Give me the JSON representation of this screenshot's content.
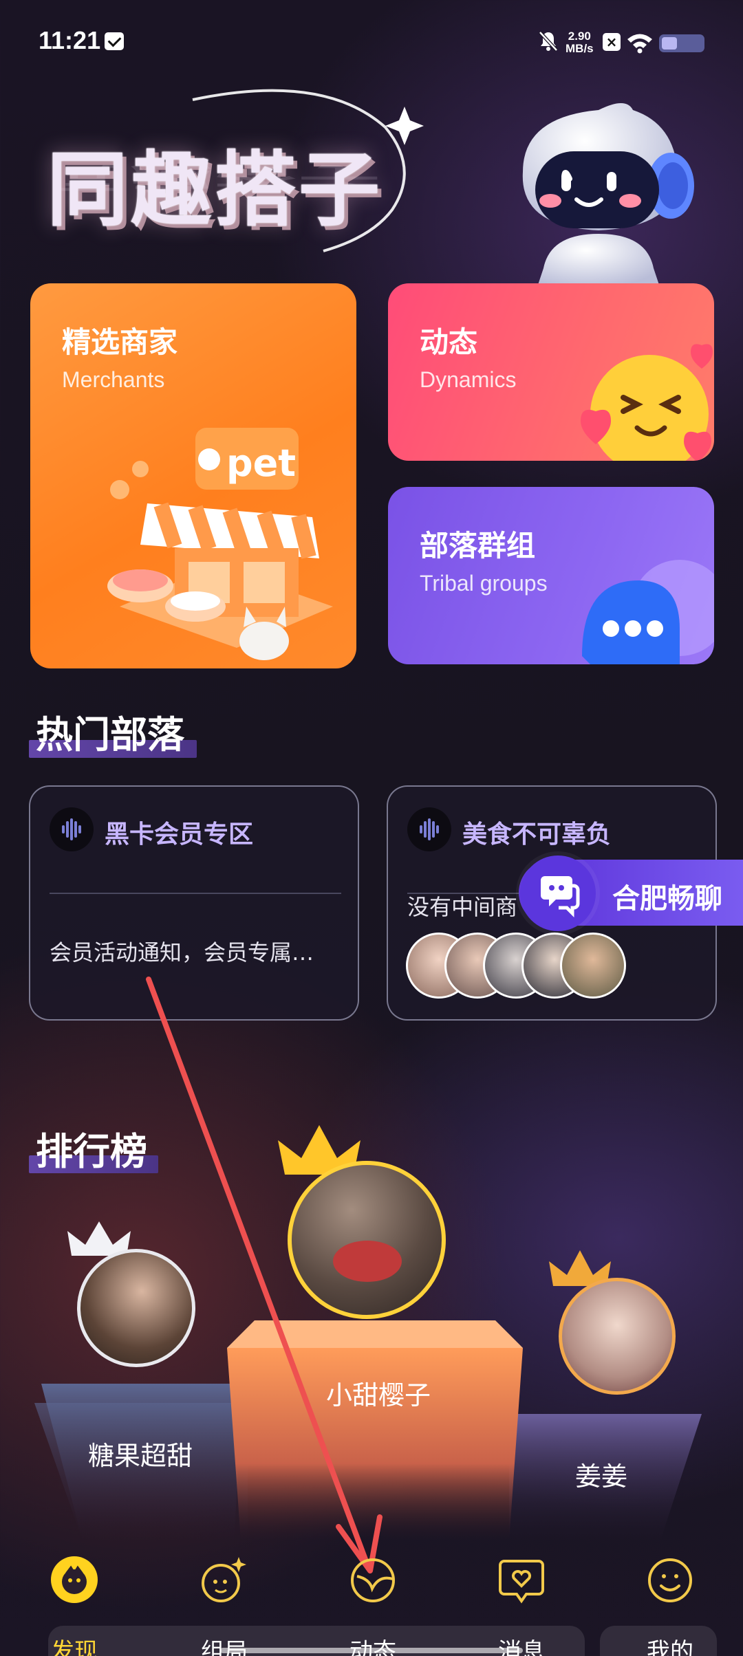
{
  "status_bar": {
    "time": "11:21",
    "net_speed_value": "2.90",
    "net_speed_unit": "MB/s"
  },
  "hero": {
    "title": "同趣搭子"
  },
  "features": [
    {
      "title": "精选商家",
      "subtitle": "Merchants",
      "illustration_text": "pet"
    },
    {
      "title": "动态",
      "subtitle": "Dynamics"
    },
    {
      "title": "部落群组",
      "subtitle": "Tribal groups"
    }
  ],
  "hot_tribes": {
    "title": "热门部落",
    "items": [
      {
        "name": "黑卡会员专区",
        "desc": "会员活动通知，会员专属…"
      },
      {
        "name": "美食不可辜负",
        "desc": "没有中间商"
      }
    ]
  },
  "chat_badge": {
    "label": "合肥畅聊"
  },
  "ranking": {
    "title": "排行榜",
    "first": {
      "name": "小甜樱子"
    },
    "second": {
      "name": "糖果超甜"
    },
    "third": {
      "name": "姜姜"
    }
  },
  "nav": [
    {
      "label": "发现",
      "icon": "discover-icon",
      "active": true
    },
    {
      "label": "组局",
      "icon": "party-icon"
    },
    {
      "label": "动态",
      "icon": "dynamics-icon"
    },
    {
      "label": "消息",
      "icon": "message-icon"
    },
    {
      "label": "我的",
      "icon": "profile-icon"
    }
  ],
  "colors": {
    "accent": "#ffe23a",
    "nav_active": "#ffd21f",
    "tribe_name": "#c7b6ff",
    "annotation_arrow": "#ee5050"
  }
}
